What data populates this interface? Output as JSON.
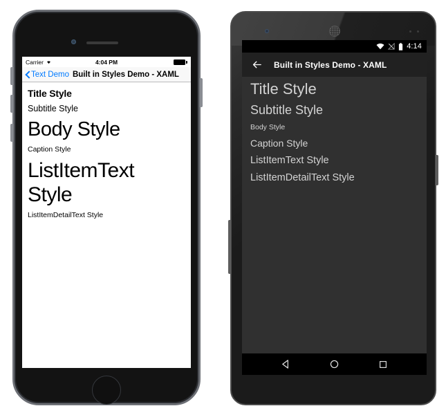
{
  "ios_device": {
    "status_bar": {
      "carrier": "Carrier",
      "wifi_icon": "wifi-icon",
      "time": "4:04 PM",
      "battery_icon": "battery-full-icon"
    },
    "nav_bar": {
      "back_icon": "chevron-left-icon",
      "back_label": "Text Demo",
      "title": "Built in Styles Demo - XAML"
    },
    "content_lines": [
      {
        "key": "title",
        "text": "Title Style"
      },
      {
        "key": "subtitle",
        "text": "Subtitle Style"
      },
      {
        "key": "body",
        "text": "Body Style"
      },
      {
        "key": "caption",
        "text": "Caption Style"
      },
      {
        "key": "listitem",
        "text": "ListItemText Style"
      },
      {
        "key": "listdetail",
        "text": "ListItemDetailText Style"
      }
    ],
    "hardware": {
      "camera": "front-camera",
      "speaker": "earpiece-speaker",
      "home_button": "home-button"
    }
  },
  "android_device": {
    "status_bar": {
      "wifi_icon": "wifi-icon",
      "signal_icon": "signal-no-sim-icon",
      "battery_icon": "battery-icon",
      "time": "4:14"
    },
    "action_bar": {
      "back_icon": "arrow-left-icon",
      "title": "Built in Styles Demo - XAML"
    },
    "content_lines": [
      {
        "key": "title",
        "text": "Title Style"
      },
      {
        "key": "subtitle",
        "text": "Subtitle Style"
      },
      {
        "key": "body",
        "text": "Body Style"
      },
      {
        "key": "caption",
        "text": "Caption Style"
      },
      {
        "key": "listitem",
        "text": "ListItemText Style"
      },
      {
        "key": "listdetail",
        "text": "ListItemDetailText Style"
      }
    ],
    "nav_bar": {
      "back": "back-triangle-icon",
      "home": "home-circle-icon",
      "recents": "recents-square-icon"
    },
    "hardware": {
      "camera": "front-camera",
      "speaker": "earpiece-speaker",
      "sensors": "proximity-sensors"
    }
  },
  "colors": {
    "ios_accent": "#007aff",
    "ios_navbar_bg": "#f8f8f8",
    "android_actionbar_bg": "#212121",
    "android_content_bg": "#303030",
    "android_text": "#d3d3d3"
  }
}
